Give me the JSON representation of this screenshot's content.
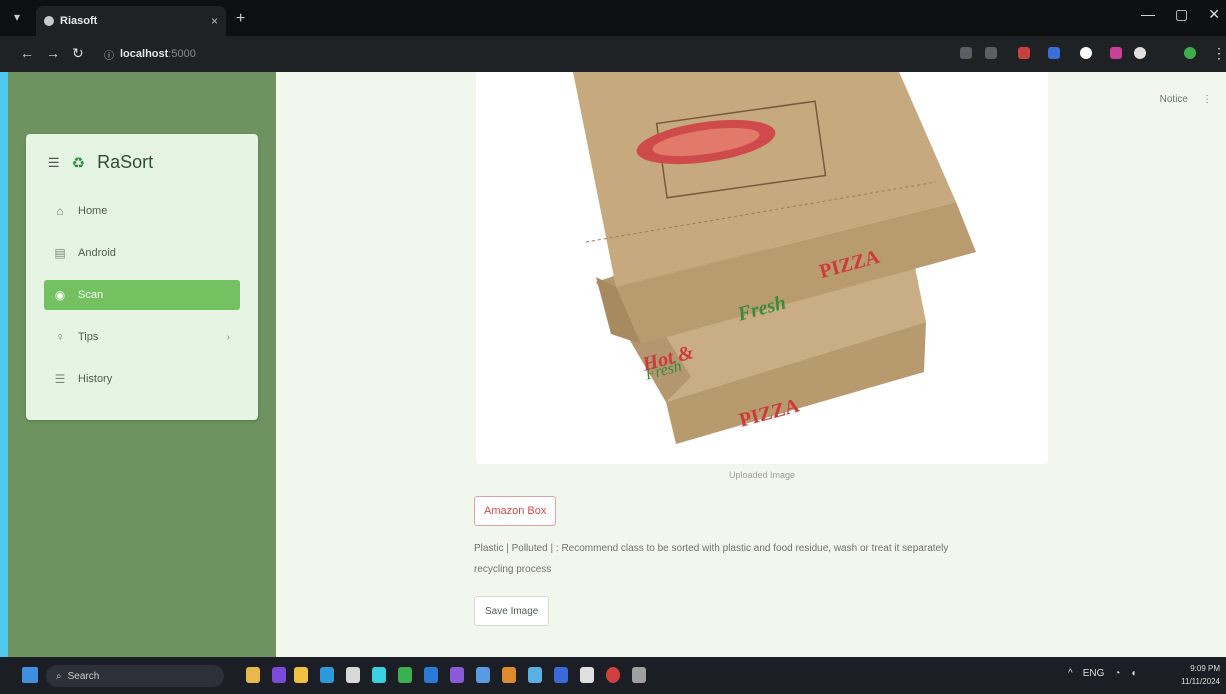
{
  "browser": {
    "tab_title": "Riasoft",
    "tab_close": "×",
    "new_tab": "+",
    "url_host": "localhost",
    "url_port": ":5000",
    "window_controls": [
      "—",
      "▢",
      "✕"
    ]
  },
  "sidebar": {
    "brand": "RaSort",
    "items": [
      {
        "icon": "home-icon",
        "glyph": "⌂",
        "label": "Home"
      },
      {
        "icon": "document-icon",
        "glyph": "▤",
        "label": "Android"
      },
      {
        "icon": "camera-icon",
        "glyph": "◉",
        "label": "Scan"
      },
      {
        "icon": "tips-icon",
        "glyph": "♀",
        "label": "Tips"
      },
      {
        "icon": "history-icon",
        "glyph": "☰",
        "label": "History"
      }
    ]
  },
  "main": {
    "top_right": [
      "Notice",
      "⋮"
    ],
    "caption": "Uploaded Image",
    "tag": "Amazon Box",
    "description": "Plastic | Polluted | : Recommend class to be sorted with plastic and food residue, wash or treat it separately",
    "description_line2": "recycling process",
    "save_button": "Save Image"
  },
  "taskbar": {
    "search_placeholder": "Search",
    "tray_lang": "ENG",
    "time": "9:09 PM",
    "date": "11/11/2024"
  },
  "colors": {
    "accent": "#73c161",
    "sidebar_bg": "#6e9360",
    "page_bg": "#f1f7ed"
  }
}
